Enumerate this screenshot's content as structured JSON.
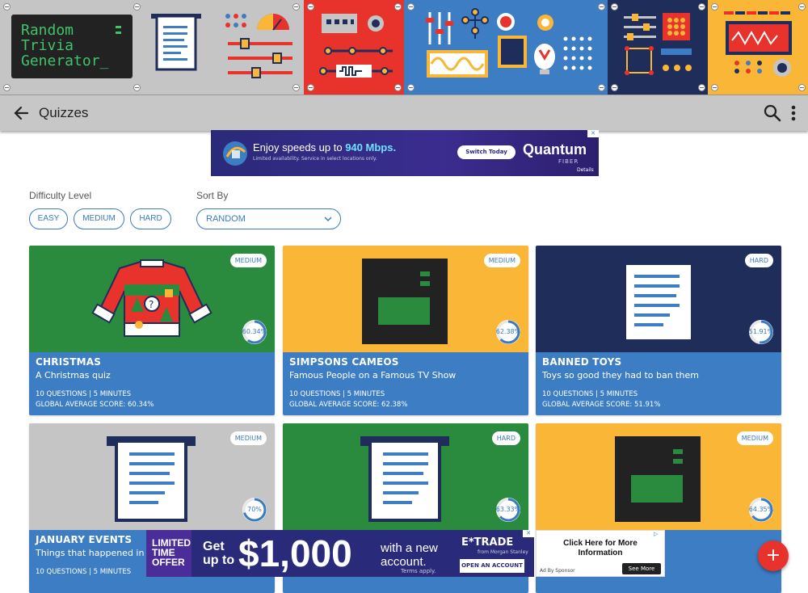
{
  "banner": {
    "logo_text": "Random\nTrivia\nGenerator_",
    "panel_colors": [
      "#c5c5c5",
      "#e8322c",
      "#3c7dc3",
      "#1e2d5a",
      "#f9b637"
    ]
  },
  "toolbar": {
    "title": "Quizzes",
    "back_icon": "arrow-left-icon",
    "search_icon": "search-icon",
    "more_icon": "more-vert-icon"
  },
  "ad_top": {
    "headline_prefix": "Enjoy speeds up to ",
    "headline_speed": "940 Mbps.",
    "fine_print": "Limited availability. Service in select locations only.",
    "cta": "Switch Today",
    "brand": "Quantum",
    "brand_sub": "FIBER",
    "details": "Details"
  },
  "filters": {
    "difficulty_label": "Difficulty Level",
    "difficulty_options": [
      "EASY",
      "MEDIUM",
      "HARD"
    ],
    "sort_label": "Sort By",
    "sort_value": "RANDOM"
  },
  "cards": [
    {
      "title": "CHRISTMAS",
      "subtitle": "A Christmas quiz",
      "meta": "10 QUESTIONS | 5 MINUTES",
      "score_text": "GLOBAL AVERAGE SCORE: 60.34%",
      "badge": "MEDIUM",
      "score": "60.34%",
      "score_value": 0.6034,
      "art": "sweater",
      "bg": "#2a8a3d"
    },
    {
      "title": "SIMPSONS CAMEOS",
      "subtitle": "Famous People on a Famous TV Show",
      "meta": "10 QUESTIONS | 5 MINUTES",
      "score_text": "GLOBAL AVERAGE SCORE: 62.38%",
      "badge": "MEDIUM",
      "score": "62.38%",
      "score_value": 0.6238,
      "art": "tv",
      "bg": "#f9b637"
    },
    {
      "title": "BANNED TOYS",
      "subtitle": "Toys so good they had to ban them",
      "meta": "10 QUESTIONS | 5 MINUTES",
      "score_text": "GLOBAL AVERAGE SCORE: 51.91%",
      "badge": "HARD",
      "score": "51.91%",
      "score_value": 0.5191,
      "art": "document",
      "bg": "#1e2d5a"
    },
    {
      "title": "JANUARY EVENTS",
      "subtitle": "Things that happened in a",
      "meta": "10 QUESTIONS | 5 MINUTES",
      "score_text": "",
      "badge": "MEDIUM",
      "score": "70%",
      "score_value": 0.7,
      "art": "printout",
      "bg": "#c5c5c5"
    },
    {
      "title": "",
      "subtitle": "",
      "meta": "",
      "score_text": "",
      "badge": "HARD",
      "score": "63.33%",
      "score_value": 0.6333,
      "art": "printout",
      "bg": "#2a8a3d"
    },
    {
      "title": "",
      "subtitle": "",
      "meta": "",
      "score_text": "",
      "badge": "MEDIUM",
      "score": "64.35%",
      "score_value": 0.6435,
      "art": "tv",
      "bg": "#f9b637"
    }
  ],
  "ad_bottom": {
    "offer": "LIMITED TIME OFFER",
    "get_up_to": "Get up to",
    "amount": "$1,000",
    "with_account": "with a new account.",
    "terms": "Terms apply.",
    "brand": "E*TRADE",
    "brand_sub": "from Morgan Stanley",
    "cta": "OPEN AN ACCOUNT"
  },
  "ad_side": {
    "headline": "Click Here for More Information",
    "by": "Ad By Sponsor",
    "cta": "See More"
  },
  "fab": {
    "label": "+"
  }
}
